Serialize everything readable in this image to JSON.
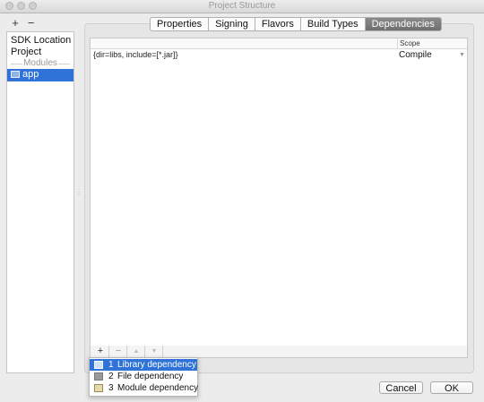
{
  "window": {
    "title": "Project Structure"
  },
  "left_toolbar": {
    "add": "+",
    "remove": "−"
  },
  "left_panel": {
    "items": [
      "SDK Location",
      "Project"
    ],
    "modules_header": "Modules",
    "modules": [
      {
        "label": "app",
        "icon": "module-folder-icon",
        "selected": true
      }
    ]
  },
  "tabs": [
    {
      "label": "Properties",
      "active": false
    },
    {
      "label": "Signing",
      "active": false
    },
    {
      "label": "Flavors",
      "active": false
    },
    {
      "label": "Build Types",
      "active": false
    },
    {
      "label": "Dependencies",
      "active": true
    }
  ],
  "dependencies_table": {
    "columns": [
      "",
      "Scope"
    ],
    "rows": [
      {
        "dependency": "{dir=libs, include=[*.jar]}",
        "scope": "Compile"
      }
    ]
  },
  "table_toolbar": {
    "add": "+",
    "remove": "−",
    "up": "▲",
    "down": "▼"
  },
  "add_menu": {
    "items": [
      {
        "number": "1",
        "label": "Library dependency",
        "icon": "library-icon",
        "selected": true
      },
      {
        "number": "2",
        "label": "File dependency",
        "icon": "file-icon",
        "selected": false
      },
      {
        "number": "3",
        "label": "Module dependency",
        "icon": "module-folder-icon",
        "selected": false
      }
    ]
  },
  "dialog_buttons": {
    "cancel": "Cancel",
    "ok": "OK"
  },
  "colors": {
    "selection": "#2f73d8",
    "active_tab": "#7b7b7b"
  }
}
